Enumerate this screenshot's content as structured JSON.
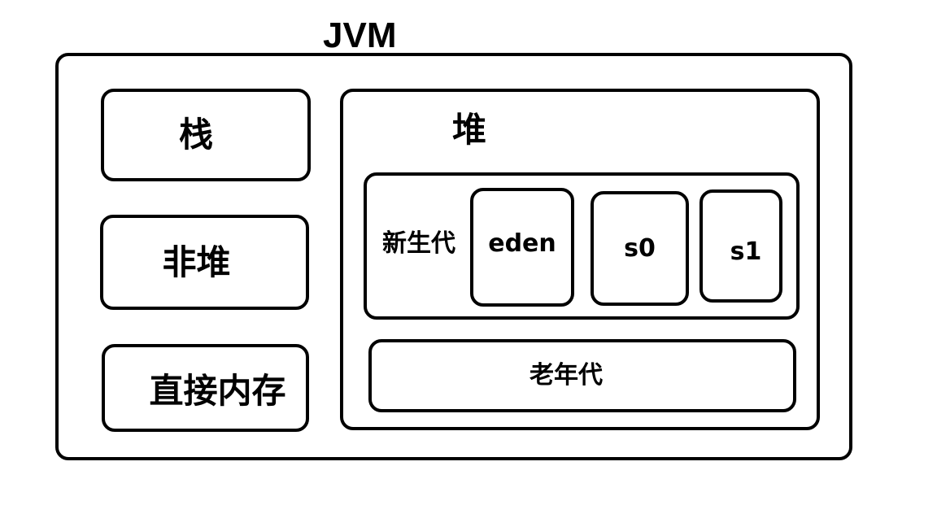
{
  "diagram": {
    "title": "JVM",
    "stack_label": "栈",
    "non_heap_label": "非堆",
    "direct_memory_label": "直接内存",
    "heap": {
      "label": "堆",
      "young_generation": {
        "label": "新生代",
        "eden_label": "eden",
        "s0_label": "s0",
        "s1_label": "s1"
      },
      "old_generation_label": "老年代"
    }
  }
}
